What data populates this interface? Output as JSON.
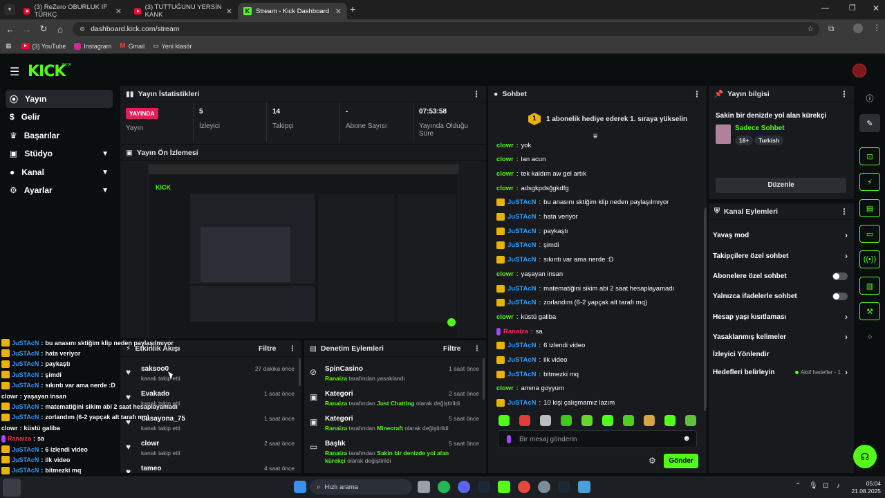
{
  "browser": {
    "tabs": [
      {
        "label": "(3) ReZero OBURLUK IF TÜRKÇ",
        "active": false
      },
      {
        "label": "(3) TUTTUĞUNU YERSİN KANK",
        "active": false
      },
      {
        "label": "Stream - Kick Dashboard",
        "active": true
      }
    ],
    "url": "dashboard.kick.com/stream",
    "bookmarks": [
      "(3) YouTube",
      "Instagram",
      "Gmail",
      "Yeni klasör"
    ]
  },
  "kick": {
    "logo": "KICK",
    "logo_beta": "BETA",
    "sidebar": [
      {
        "label": "Yayın",
        "icon": "broadcast-icon",
        "active": true,
        "chevron": false
      },
      {
        "label": "Gelir",
        "icon": "dollar-icon",
        "active": false,
        "chevron": false
      },
      {
        "label": "Başarılar",
        "icon": "trophy-icon",
        "active": false,
        "chevron": false
      },
      {
        "label": "Stüdyo",
        "icon": "studio-icon",
        "active": false,
        "chevron": true
      },
      {
        "label": "Kanal",
        "icon": "user-icon",
        "active": false,
        "chevron": true
      },
      {
        "label": "Ayarlar",
        "icon": "gear-icon",
        "active": false,
        "chevron": true
      }
    ],
    "stats": {
      "title": "Yayın İstatistikleri",
      "items": [
        {
          "value": "YAYINDA",
          "label": "Yayın"
        },
        {
          "value": "5",
          "label": "İzleyici"
        },
        {
          "value": "14",
          "label": "Takipçi"
        },
        {
          "value": "-",
          "label": "Abone Sayısı"
        },
        {
          "value": "07:53:58",
          "label": "Yayında Olduğu Süre"
        }
      ]
    },
    "preview": {
      "title": "Yayın Ön İzlemesi"
    },
    "activity": {
      "title": "Etkinlik Akışı",
      "filter": "Filtre",
      "items": [
        {
          "name": "saksoo0",
          "sub": "kanalı takip etti",
          "time": "27 dakika önce"
        },
        {
          "name": "Evakado",
          "sub": "kanalı takip etti",
          "time": "1 saat önce"
        },
        {
          "name": "Casayona_75",
          "sub": "kanalı takip etti",
          "time": "1 saat önce"
        },
        {
          "name": "clowr",
          "sub": "kanalı takip etti",
          "time": "2 saat önce"
        },
        {
          "name": "tameo",
          "sub": "",
          "time": "4 saat önce"
        }
      ]
    },
    "moderation": {
      "title": "Denetim Eylemleri",
      "filter": "Filtre",
      "items": [
        {
          "title": "SpinCasino",
          "by": "Ranaiza",
          "text": "tarafından yasaklandı",
          "highlight": "",
          "after": "",
          "time": "1 saat önce"
        },
        {
          "title": "Kategori",
          "by": "Ranaiza",
          "text": "tarafından",
          "highlight": "Just Chatting",
          "after": "olarak değiştirildi",
          "time": "2 saat önce"
        },
        {
          "title": "Kategori",
          "by": "Ranaiza",
          "text": "tarafından",
          "highlight": "Minecraft",
          "after": "olarak değiştirildi",
          "time": "5 saat önce"
        },
        {
          "title": "Başlık",
          "by": "Ranaiza",
          "text": "tarafından",
          "highlight": "Sakin bir denizde yol alan kürekçi",
          "after": "olarak değiştirildi",
          "time": "5 saat önce"
        }
      ]
    },
    "chat": {
      "title": "Sohbet",
      "pinned": "1 abonelik hediye ederek 1. sıraya yükselin",
      "pinned_rank": "1",
      "messages": [
        {
          "user": "clowr",
          "text": "yok",
          "badge": "",
          "color": "#53fc18"
        },
        {
          "user": "clowr",
          "text": "lan acun",
          "badge": "",
          "color": "#53fc18"
        },
        {
          "user": "clowr",
          "text": "tek kaldım aw gel artık",
          "badge": "",
          "color": "#53fc18"
        },
        {
          "user": "clowr",
          "text": "adsgkpdsğgkdfg",
          "badge": "",
          "color": "#53fc18"
        },
        {
          "user": "JuSTAcN",
          "text": "bu anasını sktiğim klip neden paylaşılmıyor",
          "badge": "crown",
          "color": "#2f9fff"
        },
        {
          "user": "JuSTAcN",
          "text": "hata veriyor",
          "badge": "crown",
          "color": "#2f9fff"
        },
        {
          "user": "JuSTAcN",
          "text": "paykaştı",
          "badge": "crown",
          "color": "#2f9fff"
        },
        {
          "user": "JuSTAcN",
          "text": "şimdi",
          "badge": "crown",
          "color": "#2f9fff"
        },
        {
          "user": "JuSTAcN",
          "text": "sıkıntı var ama nerde :D",
          "badge": "crown",
          "color": "#2f9fff"
        },
        {
          "user": "clowr",
          "text": "yaşayan insan",
          "badge": "",
          "color": "#53fc18"
        },
        {
          "user": "JuSTAcN",
          "text": "matematiğini sikim abi 2 saat hesaplayamadı",
          "badge": "crown",
          "color": "#2f9fff"
        },
        {
          "user": "JuSTAcN",
          "text": "zorlandım (6-2 yapçak alt tarafı mq)",
          "badge": "crown",
          "color": "#2f9fff"
        },
        {
          "user": "clowr",
          "text": "küstü galiba",
          "badge": "",
          "color": "#53fc18"
        },
        {
          "user": "Ranaiza",
          "text": "sa",
          "badge": "mod",
          "color": "#ff2d55"
        },
        {
          "user": "JuSTAcN",
          "text": "6 izlendi video",
          "badge": "crown",
          "color": "#2f9fff"
        },
        {
          "user": "JuSTAcN",
          "text": "ilk video",
          "badge": "crown",
          "color": "#2f9fff"
        },
        {
          "user": "JuSTAcN",
          "text": "bitmezki mq",
          "badge": "crown",
          "color": "#2f9fff"
        },
        {
          "user": "clowr",
          "text": "amına goyyum",
          "badge": "",
          "color": "#53fc18"
        },
        {
          "user": "JuSTAcN",
          "text": "10 kişi çalışmamız lazım",
          "badge": "crown",
          "color": "#2f9fff"
        }
      ],
      "placeholder": "Bir mesaj gönderin",
      "send": "Gönder"
    },
    "stream_info": {
      "title": "Yayın bilgisi",
      "stream_title": "Sakin bir denizde yol alan kürekçi",
      "category": "Sadece Sohbet",
      "tags": [
        "18+",
        "Turkish"
      ],
      "edit": "Düzenle"
    },
    "channel_actions": {
      "title": "Kanal Eylemleri",
      "items": [
        {
          "label": "Yavaş mod",
          "control": "chevron"
        },
        {
          "label": "Takipçilere özel sohbet",
          "control": "chevron"
        },
        {
          "label": "Abonelere özel sohbet",
          "control": "toggle"
        },
        {
          "label": "Yalnızca ifadelerle sohbet",
          "control": "toggle"
        },
        {
          "label": "Hesap yaşı kısıtlaması",
          "control": "chevron"
        },
        {
          "label": "Yasaklanmış kelimeler",
          "control": "chevron"
        },
        {
          "label": "İzleyici Yönlendir",
          "control": "none"
        },
        {
          "label": "Hedefleri belirleyin",
          "control": "goal"
        }
      ],
      "goal_text": "Aktif hedefler - 1"
    }
  },
  "overlay_chat": [
    {
      "user": "JuSTAcN",
      "text": "bu anasını sktiğim klip neden paylaşılmıyor"
    },
    {
      "user": "JuSTAcN",
      "text": "hata veriyor"
    },
    {
      "user": "JuSTAcN",
      "text": "paykaştı"
    },
    {
      "user": "JuSTAcN",
      "text": "şimdi"
    },
    {
      "user": "JuSTAcN",
      "text": "sıkıntı var ama nerde :D"
    },
    {
      "user": "clowr",
      "text": "yaşayan insan"
    },
    {
      "user": "JuSTAcN",
      "text": "matematiğini sikim abi 2 saat hesaplayamadı"
    },
    {
      "user": "JuSTAcN",
      "text": "zorlandım (6-2 yapçak alt tarafı mq)"
    },
    {
      "user": "clowr",
      "text": "küstü galiba"
    },
    {
      "user": "Ranaiza",
      "text": "sa"
    },
    {
      "user": "JuSTAcN",
      "text": "6 izlendi video"
    },
    {
      "user": "JuSTAcN",
      "text": "ilk video"
    },
    {
      "user": "JuSTAcN",
      "text": "bitmezki mq"
    },
    {
      "user": "clowr",
      "text": "amına goyyum"
    },
    {
      "user": "JuSTAcN",
      "text": "10 kişi çalışmamız lazım"
    }
  ],
  "taskbar": {
    "search": "Hızlı arama",
    "time": "05:04",
    "date": "21.08.2025"
  },
  "colors": {
    "accent": "#53fc18",
    "live": "#e01e5a",
    "panel": "#181a1d",
    "bg": "#0b0e0f"
  }
}
